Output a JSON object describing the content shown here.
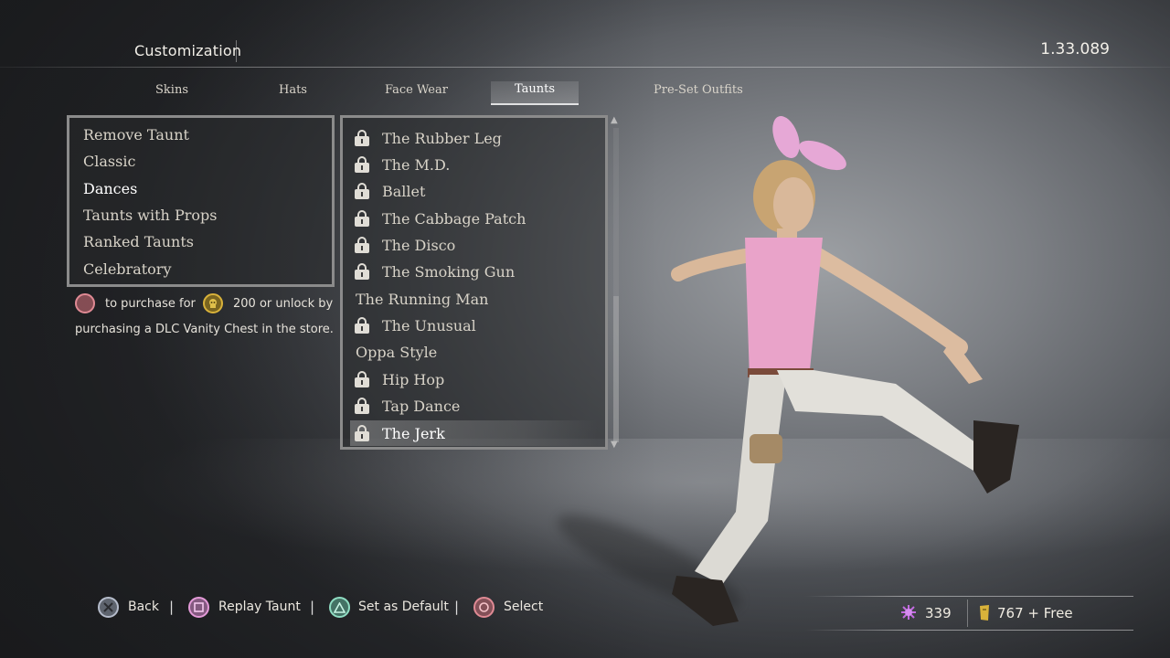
{
  "header": {
    "title": "Customization",
    "version": "1.33.089"
  },
  "tabs": [
    {
      "label": "Skins"
    },
    {
      "label": "Hats"
    },
    {
      "label": "Face Wear"
    },
    {
      "label": "Taunts",
      "active": true
    },
    {
      "label": "Pre-Set Outfits"
    }
  ],
  "categories": [
    {
      "label": "Remove Taunt"
    },
    {
      "label": "Classic"
    },
    {
      "label": "Dances",
      "selected": true
    },
    {
      "label": "Taunts with Props"
    },
    {
      "label": "Ranked Taunts"
    },
    {
      "label": "Celebratory"
    }
  ],
  "taunts": [
    {
      "label": "The Rubber Leg",
      "locked": true
    },
    {
      "label": "The M.D.",
      "locked": true
    },
    {
      "label": "Ballet",
      "locked": true
    },
    {
      "label": "The Cabbage Patch",
      "locked": true
    },
    {
      "label": "The Disco",
      "locked": true
    },
    {
      "label": "The Smoking Gun",
      "locked": true
    },
    {
      "label": "The Running Man",
      "locked": false
    },
    {
      "label": "The Unusual",
      "locked": true
    },
    {
      "label": "Oppa Style",
      "locked": false
    },
    {
      "label": "Hip Hop",
      "locked": true
    },
    {
      "label": "Tap Dance",
      "locked": true
    },
    {
      "label": "The Jerk",
      "locked": true,
      "selected": true
    }
  ],
  "purchase": {
    "line1_prefix": "to purchase for",
    "line1_suffix": "200 or unlock by",
    "line2": "purchasing a DLC Vanity Chest in the store."
  },
  "footer": {
    "back": "Back",
    "replay": "Replay Taunt",
    "set_default": "Set as Default",
    "select": "Select",
    "separator": "|"
  },
  "currency": {
    "relics": "339",
    "treasure": "767 + Free"
  },
  "colors": {
    "circle_button": "#d9727e",
    "square_button": "#d98ad0",
    "triangle_button": "#6fd3b4",
    "cross_button": "#a9b8d8",
    "relic_purple": "#c26be0",
    "treasure_gold": "#d9b23a"
  }
}
